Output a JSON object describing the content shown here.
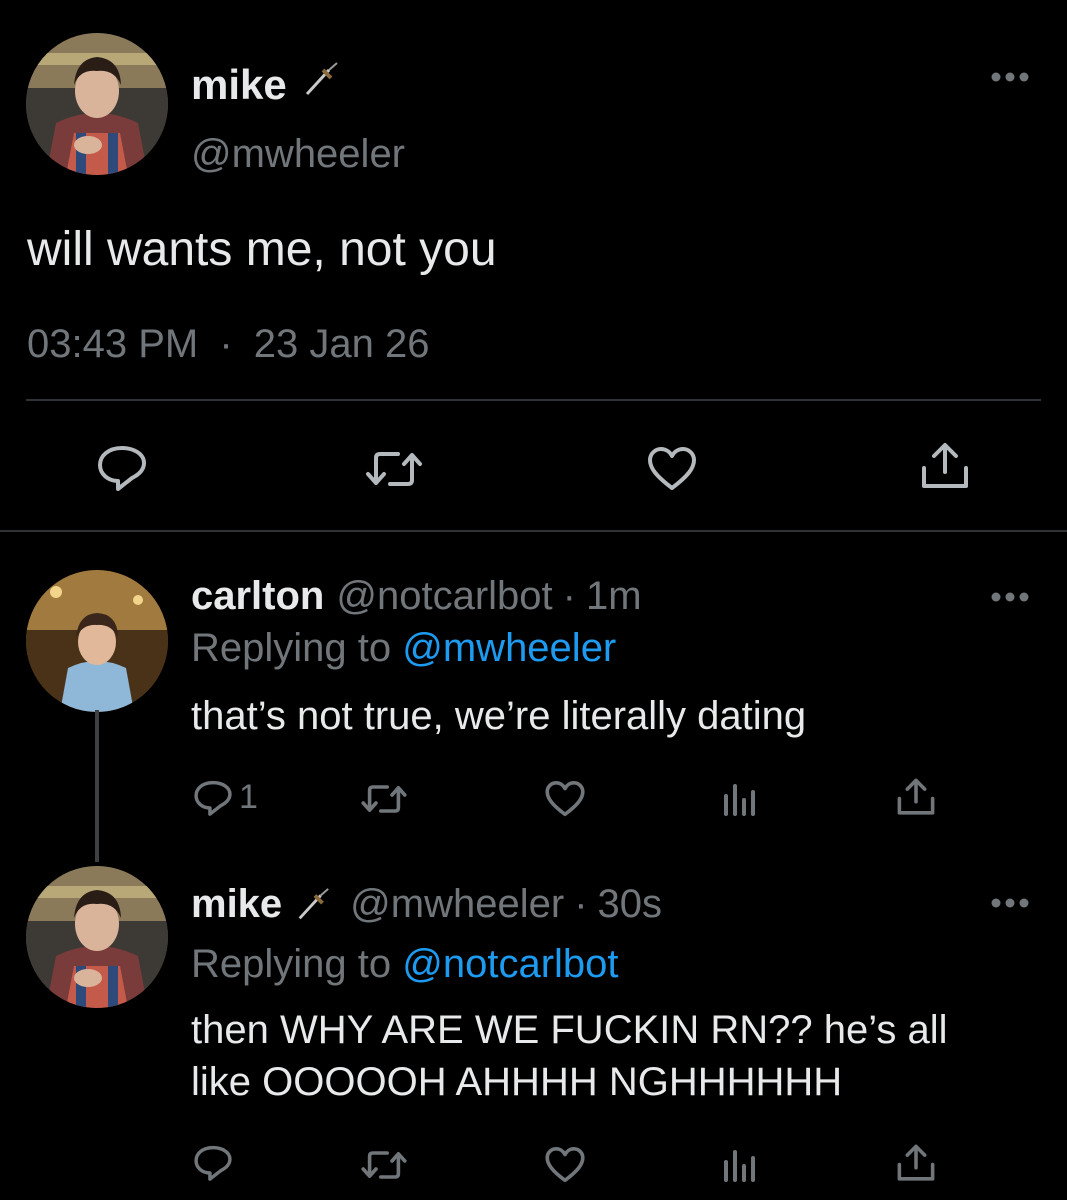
{
  "main_tweet": {
    "name": "mike",
    "handle": "@mwheeler",
    "text": "will wants me, not you",
    "time": "03:43 PM",
    "separator": "·",
    "date": "23 Jan 26"
  },
  "replies": [
    {
      "name": "carlton",
      "handle": "@notcarlbot",
      "age": "1m",
      "replying_prefix": "Replying to",
      "replying_to": "@mwheeler",
      "text_lines": [
        "that’s not true, we’re literally dating"
      ],
      "reply_count": "1"
    },
    {
      "name": "mike",
      "handle": "@mwheeler",
      "age": "30s",
      "replying_prefix": "Replying to",
      "replying_to": "@notcarlbot",
      "text_lines": [
        "then WHY ARE WE FUCKIN RN?? he’s all",
        "like OOOOOH AHHHH NGHHHHHH"
      ]
    }
  ],
  "icons": {
    "name_badge": "dagger-icon",
    "more": "more-icon",
    "reply": "reply-icon",
    "retweet": "retweet-icon",
    "like": "heart-icon",
    "analytics": "analytics-icon",
    "share": "share-icon"
  },
  "colors": {
    "background": "#000000",
    "text": "#e7e9ea",
    "muted": "#71767b",
    "link": "#1d9bf0",
    "divider": "#2f3336"
  }
}
